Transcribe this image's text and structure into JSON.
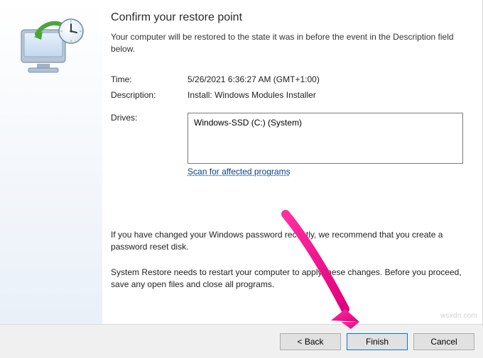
{
  "title": "Confirm your restore point",
  "subtitle": "Your computer will be restored to the state it was in before the event in the Description field below.",
  "info": {
    "time_label": "Time:",
    "time_value": "5/26/2021 6:36:27 AM (GMT+1:00)",
    "description_label": "Description:",
    "description_value": "Install: Windows Modules Installer",
    "drives_label": "Drives:",
    "drives_value": "Windows-SSD (C:) (System)"
  },
  "scan_link": "Scan for affected programs",
  "notes": {
    "password_note": "If you have changed your Windows password recently, we recommend that you create a password reset disk.",
    "restart_note": "System Restore needs to restart your computer to apply these changes. Before you proceed, save any open files and close all programs."
  },
  "buttons": {
    "back": "< Back",
    "finish": "Finish",
    "cancel": "Cancel"
  },
  "icon": "system-restore-icon",
  "watermark": "wsxdn.com"
}
